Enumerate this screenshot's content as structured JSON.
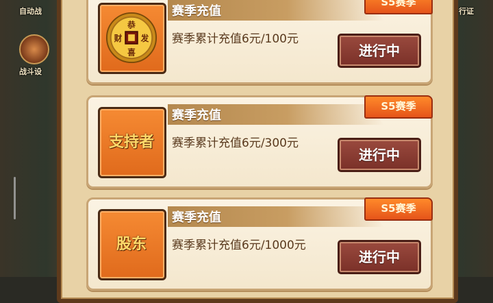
{
  "background": {
    "left_labels": [
      "自动战",
      "战斗设"
    ],
    "right_labels": [
      "行证"
    ]
  },
  "cards": [
    {
      "title": "赛季充值",
      "description": "赛季累计充值6元/100元",
      "badge": "S5赛季",
      "button": "进行中",
      "icon": "coin-icon",
      "coin_chars": [
        "恭",
        "发",
        "喜",
        "财"
      ]
    },
    {
      "title": "赛季充值",
      "description": "赛季累计充值6元/300元",
      "badge": "S5赛季",
      "button": "进行中",
      "icon": "supporter-emblem-icon",
      "emblem_text": "支持者"
    },
    {
      "title": "赛季充值",
      "description": "赛季累计充值6元/1000元",
      "badge": "S5赛季",
      "button": "进行中",
      "icon": "shareholder-emblem-icon",
      "emblem_text": "股东"
    }
  ],
  "colors": {
    "badge": "#e5541a",
    "button": "#7a3028",
    "thumb": "#f07a28",
    "panel": "#e8d2a6"
  }
}
